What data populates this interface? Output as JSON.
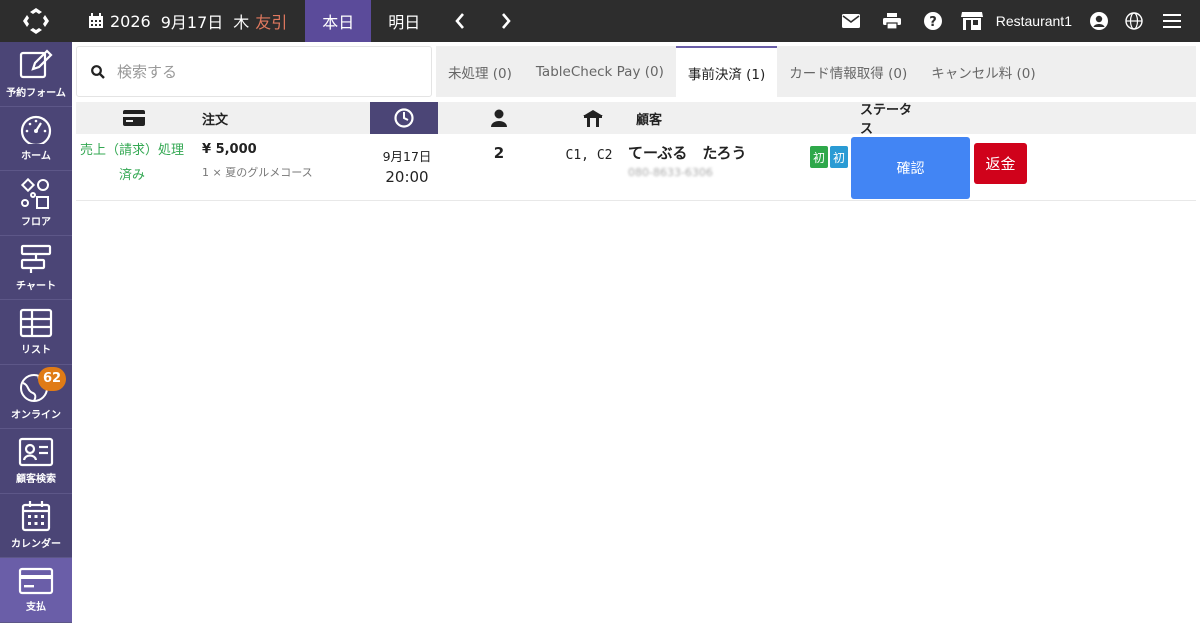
{
  "header": {
    "year": "2026",
    "date": "9月17日",
    "weekday": "木",
    "rokuyo": "友引",
    "today_label": "本日",
    "tomorrow_label": "明日",
    "prev_icon": "chevron-left-icon",
    "next_icon": "chevron-right-icon",
    "restaurant_name": "Restaurant1",
    "right_icons": [
      "mail-icon",
      "print-icon",
      "help-icon",
      "store-icon",
      "user-icon",
      "globe-icon",
      "menu-icon"
    ]
  },
  "sidebar": {
    "items": [
      {
        "label": "予約フォーム",
        "icon": "edit-icon"
      },
      {
        "label": "ホーム",
        "icon": "gauge-icon"
      },
      {
        "label": "フロア",
        "icon": "shapes-icon"
      },
      {
        "label": "チャート",
        "icon": "chart-icon"
      },
      {
        "label": "リスト",
        "icon": "table-icon"
      },
      {
        "label": "オンライン",
        "icon": "globe-icon",
        "badge": "62"
      },
      {
        "label": "顧客検索",
        "icon": "id-card-icon"
      },
      {
        "label": "カレンダー",
        "icon": "calendar-icon"
      },
      {
        "label": "支払",
        "icon": "credit-card-icon",
        "active": true
      }
    ]
  },
  "search": {
    "placeholder": "検索する"
  },
  "tabs": [
    {
      "label": "未処理 (0)"
    },
    {
      "label": "TableCheck Pay (0)"
    },
    {
      "label": "事前決済 (1)",
      "active": true
    },
    {
      "label": "カード情報取得 (0)"
    },
    {
      "label": "キャンセル料 (0)"
    }
  ],
  "table": {
    "headers": {
      "payment_icon": "credit-card-icon",
      "order": "注文",
      "time_icon": "clock-icon",
      "guests_icon": "person-icon",
      "table_icon": "table-seat-icon",
      "customer": "顧客",
      "status": "ステータス"
    },
    "rows": [
      {
        "payment_status": "売上（請求）処理済み",
        "price": "¥ 5,000",
        "course": "1 × 夏のグルメコース",
        "date": "9月17日",
        "time": "20:00",
        "guests": "2",
        "tables": "C1, C2",
        "customer_name": "てーぶる　たろう",
        "phone": "080-8633-6306",
        "tags": [
          "初",
          "初"
        ],
        "confirm_label": "確認",
        "refund_label": "返金"
      }
    ]
  },
  "colors": {
    "topbar": "#2d2d2d",
    "sidebar": "#4b4576",
    "accent": "#5b4b9a",
    "confirm": "#4285f4",
    "refund": "#d0021b",
    "status_green": "#34a853",
    "badge": "#e07b16"
  }
}
